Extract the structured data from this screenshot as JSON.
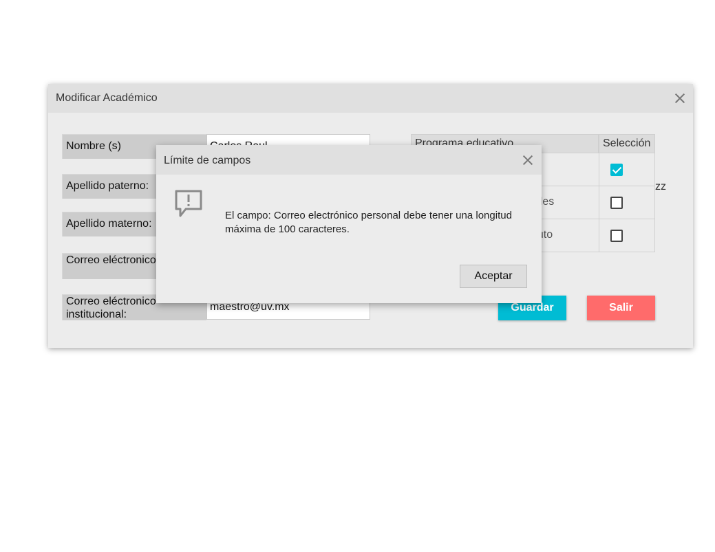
{
  "main_dialog": {
    "title": "Modificar Académico",
    "fields": [
      {
        "label": "Nombre (s)",
        "value": "Carlos Raul"
      },
      {
        "label": "Apellido paterno:",
        "value": ""
      },
      {
        "label": "Apellido materno:",
        "value": ""
      },
      {
        "label": "Correo eléctronico personal:",
        "value": ""
      },
      {
        "label": "Correo eléctronico institucional:",
        "value": "maestro@uv.mx"
      }
    ],
    "table": {
      "headers": [
        "Programa educativo",
        "Selección"
      ],
      "rows": [
        {
          "name": "",
          "selected": true
        },
        {
          "name": "nales",
          "selected": false
        },
        {
          "name": "puto",
          "selected": false
        }
      ]
    },
    "overflow_text": "zz",
    "save_label": "Guardar",
    "exit_label": "Salir",
    "colors": {
      "save": "#00bcd4",
      "exit": "#ff6b6b",
      "checkbox": "#00bcd4"
    }
  },
  "alert": {
    "title": "Límite de campos",
    "message": "El campo: Correo electrónico personal debe tener una longitud máxima de 100 caracteres.",
    "accept_label": "Aceptar",
    "icon": "comment-alert-icon"
  }
}
